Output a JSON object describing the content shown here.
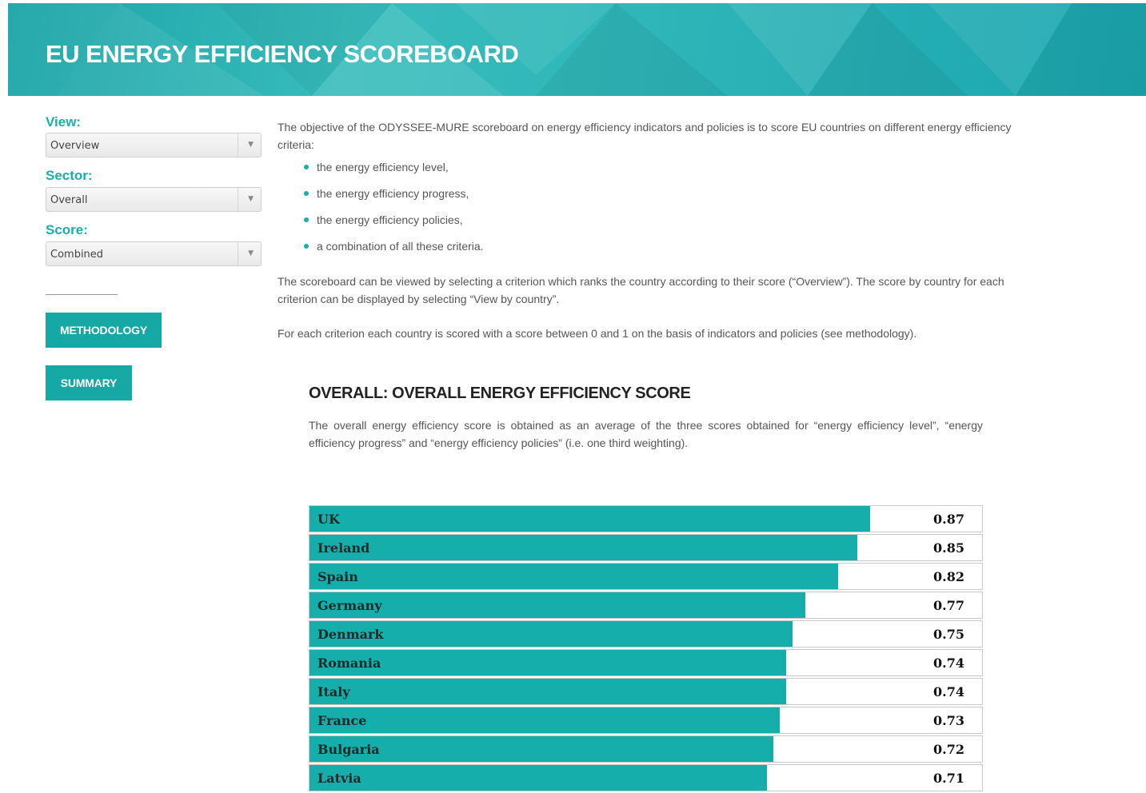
{
  "header": {
    "title": "EU ENERGY EFFICIENCY SCOREBOARD"
  },
  "sidebar": {
    "view": {
      "label": "View:",
      "value": "Overview"
    },
    "sector": {
      "label": "Sector:",
      "value": "Overall"
    },
    "score": {
      "label": "Score:",
      "value": "Combined"
    },
    "methodology_label": "METHODOLOGY",
    "summary_label": "SUMMARY"
  },
  "intro": {
    "p1": "The objective of the ODYSSEE-MURE scoreboard on energy efficiency indicators and policies is to score EU countries on different energy efficiency criteria:",
    "bullets": [
      "the energy efficiency level,",
      "the energy efficiency progress,",
      "the energy efficiency policies,",
      "a combination of all these criteria."
    ],
    "p2": "The scoreboard can be viewed by selecting a criterion which ranks the country according to their score (“Overview”). The score by country for each criterion can be displayed by selecting “View by country”.",
    "p3": "For each criterion each country is scored with a score between 0 and 1 on the basis of indicators and policies (see methodology)."
  },
  "section": {
    "title": "OVERALL: OVERALL ENERGY EFFICIENCY SCORE",
    "description": "The overall energy efficiency score is obtained as an average of the three scores obtained for “energy efficiency level”, “energy efficiency progress” and “energy efficiency policies” (i.e. one third weighting)."
  },
  "colors": {
    "accent": "#15aeaa",
    "label": "#1aaeaa"
  },
  "chart_data": {
    "type": "bar",
    "orientation": "horizontal",
    "categories": [
      "UK",
      "Ireland",
      "Spain",
      "Germany",
      "Denmark",
      "Romania",
      "Italy",
      "France",
      "Bulgaria",
      "Latvia"
    ],
    "values": [
      0.87,
      0.85,
      0.82,
      0.77,
      0.75,
      0.74,
      0.74,
      0.73,
      0.72,
      0.71
    ],
    "labels": [
      "0.87",
      "0.85",
      "0.82",
      "0.77",
      "0.75",
      "0.74",
      "0.74",
      "0.73",
      "0.72",
      "0.71"
    ],
    "xlim": [
      0,
      1
    ]
  }
}
